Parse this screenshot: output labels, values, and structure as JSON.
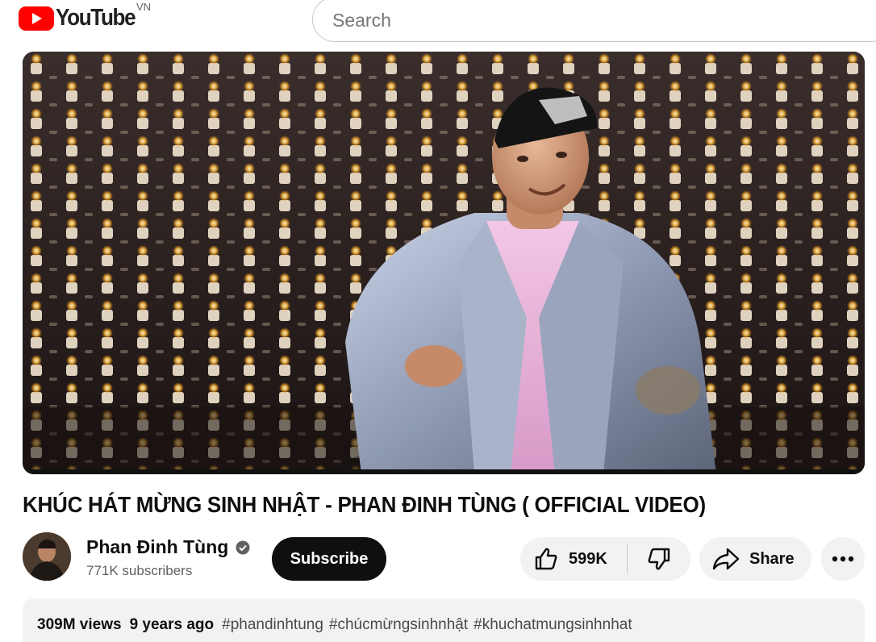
{
  "header": {
    "logo_text": "YouTube",
    "country_code": "VN",
    "search_placeholder": "Search"
  },
  "video": {
    "title": "KHÚC HÁT MỪNG SINH NHẬT - PHAN ĐINH TÙNG ( OFFICIAL VIDEO)",
    "views": "309M views",
    "published": "9 years ago",
    "hashtags": [
      "#phandinhtung",
      "#chúcmừngsinhnhật",
      "#khuchatmungsinhnhat"
    ]
  },
  "channel": {
    "name": "Phan Đinh Tùng",
    "subscribers": "771K subscribers",
    "verified_icon": "verified-icon"
  },
  "actions": {
    "subscribe_label": "Subscribe",
    "like_count": "599K",
    "share_label": "Share",
    "more_icon": "more-horizontal-icon"
  },
  "colors": {
    "youtube_red": "#ff0000",
    "subscribe_bg": "#0f0f0f",
    "pill_bg": "#f2f2f2"
  }
}
